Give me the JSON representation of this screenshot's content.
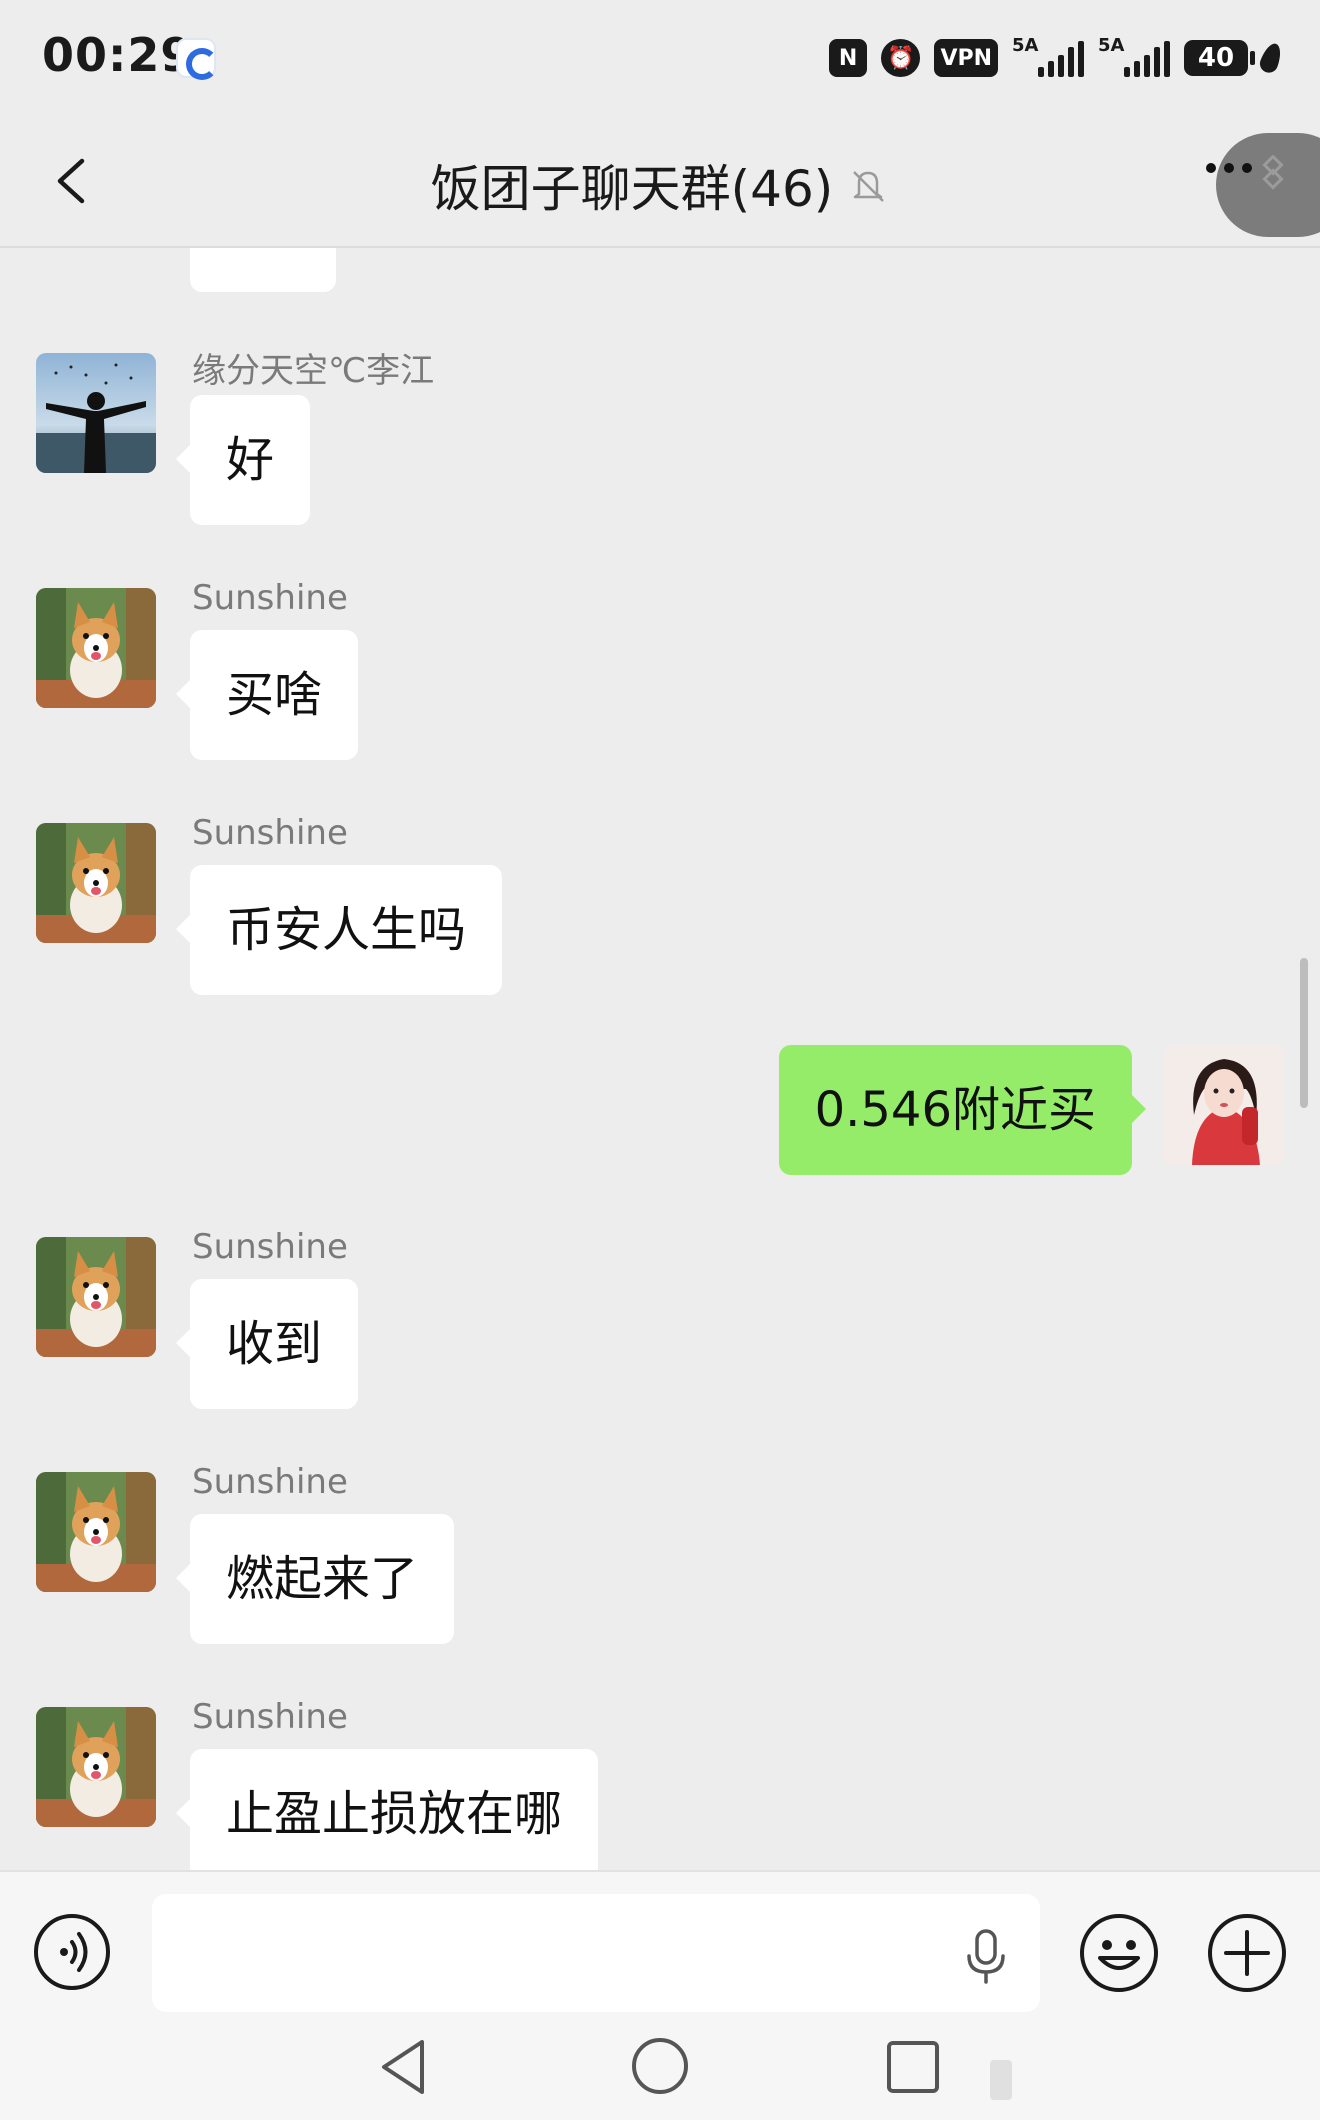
{
  "status_bar": {
    "time": "00:29",
    "vpn_label": "VPN",
    "network1": "5A",
    "network2": "5A",
    "battery": "40"
  },
  "header": {
    "title": "饭团子聊天群(46)",
    "muted": true
  },
  "messages": [
    {
      "side": "left",
      "sender": "缘分天空℃李江",
      "avatar": "silhouette-avatar",
      "text": "好"
    },
    {
      "side": "left",
      "sender": "Sunshine",
      "avatar": "corgi-avatar",
      "text": "买啥"
    },
    {
      "side": "left",
      "sender": "Sunshine",
      "avatar": "corgi-avatar",
      "text": "币安人生吗"
    },
    {
      "side": "right",
      "sender": "",
      "avatar": "girl-avatar",
      "text": "0.546附近买"
    },
    {
      "side": "left",
      "sender": "Sunshine",
      "avatar": "corgi-avatar",
      "text": "收到"
    },
    {
      "side": "left",
      "sender": "Sunshine",
      "avatar": "corgi-avatar",
      "text": "燃起来了"
    },
    {
      "side": "left",
      "sender": "Sunshine",
      "avatar": "corgi-avatar",
      "text": "止盈止损放在哪"
    }
  ],
  "input": {
    "value": "",
    "placeholder": ""
  },
  "colors": {
    "chat_bg": "#ededed",
    "bubble_left": "#ffffff",
    "bubble_right": "#95ec69"
  },
  "icons": [
    "back-arrow-icon",
    "mute-bell-icon",
    "more-icon",
    "voice-icon",
    "mic-icon",
    "emoji-icon",
    "plus-icon",
    "nav-back-icon",
    "nav-home-icon",
    "nav-recent-icon"
  ]
}
